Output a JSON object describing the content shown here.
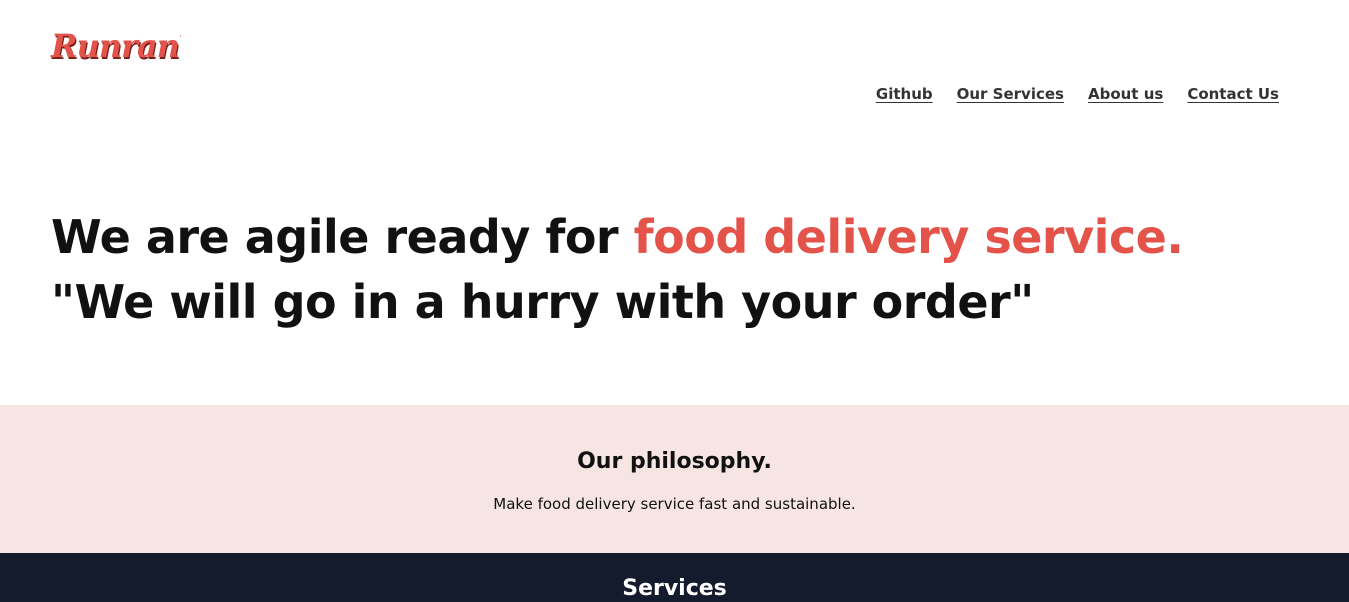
{
  "brand": {
    "logo_text": "Runran",
    "color": "#e4534a"
  },
  "nav": {
    "items": [
      {
        "label": "Github"
      },
      {
        "label": "Our Services"
      },
      {
        "label": "About us"
      },
      {
        "label": "Contact Us"
      }
    ]
  },
  "hero": {
    "line1_prefix": "We are agile ready for ",
    "line1_accent": "food delivery service.",
    "line2": "\"We will go in a hurry with your order\"",
    "accent_color": "#e4534a"
  },
  "philosophy": {
    "title": "Our philosophy.",
    "text": "Make food delivery service fast and sustainable.",
    "background": "#f7e5e4"
  },
  "services": {
    "title": "Services",
    "background": "#141b2d"
  },
  "icons": {
    "logo_flame": "flame-icon"
  }
}
